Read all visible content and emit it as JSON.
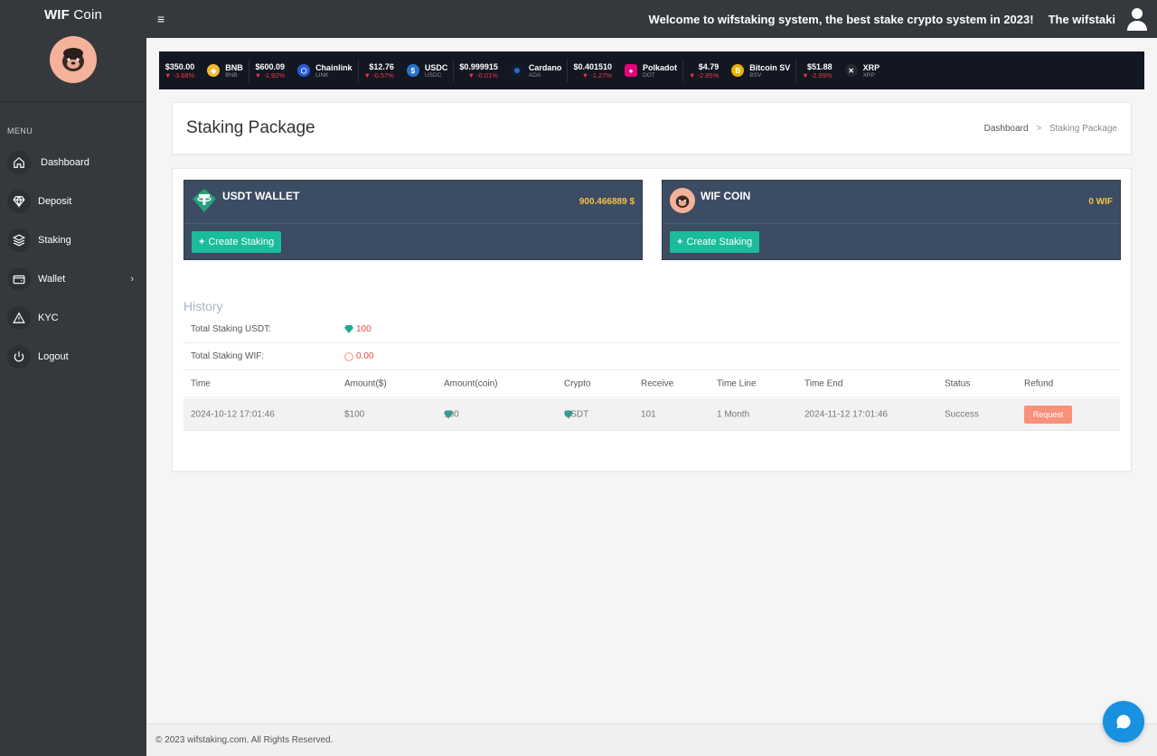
{
  "brand": {
    "name_bold": "WIF",
    "name_rest": " Coin"
  },
  "sidebar": {
    "menu_title": "MENU",
    "items": [
      {
        "label": "Dashboard",
        "icon": "home-icon"
      },
      {
        "label": "Deposit",
        "icon": "diamond-icon"
      },
      {
        "label": "Staking",
        "icon": "layers-icon"
      },
      {
        "label": "Wallet",
        "icon": "wallet-icon",
        "chevron": "›"
      },
      {
        "label": "KYC",
        "icon": "warning-icon"
      },
      {
        "label": "Logout",
        "icon": "power-icon"
      }
    ]
  },
  "header": {
    "menu_glyph": "≡",
    "welcome": "Welcome to wifstaking system, the best stake crypto system in 2023!",
    "username": "The wifstaki"
  },
  "ticker": [
    {
      "price": "$350.00",
      "change": "▼ -3.68%",
      "name": "BNB",
      "sym": "BNB",
      "color": "#f3ba2f"
    },
    {
      "price": "$600.09",
      "change": "▼ -1.92%",
      "name": "Chainlink",
      "sym": "LINK",
      "color": "#2a5ada"
    },
    {
      "price": "$12.76",
      "change": "▼ -0.57%",
      "name": "USDC",
      "sym": "USDC",
      "color": "#2775ca"
    },
    {
      "price": "$0.999915",
      "change": "▼ -0.01%",
      "name": "Cardano",
      "sym": "ADA",
      "color": "#0d1e30"
    },
    {
      "price": "$0.401510",
      "change": "▼ -1.27%",
      "name": "Polkadot",
      "sym": "DOT",
      "color": "#e6007a"
    },
    {
      "price": "$4.79",
      "change": "▼ -2.95%",
      "name": "Bitcoin SV",
      "sym": "BSV",
      "color": "#eab300"
    },
    {
      "price": "$51.88",
      "change": "▼ -2.99%",
      "name": "XRP",
      "sym": "XRP",
      "color": "#23292f"
    }
  ],
  "page": {
    "title": "Staking Package",
    "breadcrumb_home": "Dashboard",
    "breadcrumb_sep": ">",
    "breadcrumb_current": "Staking Package"
  },
  "wallets": [
    {
      "name": "USDT WALLET",
      "balance": "900.466889 $",
      "button": "Create Staking"
    },
    {
      "name": "WIF COIN",
      "balance": "0 WIF",
      "button": "Create Staking"
    }
  ],
  "history": {
    "title": "History",
    "total_usdt_label": "Total Staking USDT:",
    "total_usdt_value": "100",
    "total_wif_label": "Total Staking WIF:",
    "total_wif_value": "0.00",
    "columns": [
      "Time",
      "Amount($)",
      "Amount(coin)",
      "Crypto",
      "Receive",
      "Time Line",
      "Time End",
      "Status",
      "Refund"
    ],
    "rows": [
      {
        "time": "2024-10-12 17:01:46",
        "amount_usd": "$100",
        "amount_coin": "100",
        "crypto": "USDT",
        "receive": "101",
        "timeline": "1 Month",
        "time_end": "2024-11-12 17:01:46",
        "status": "Success",
        "refund": "Request"
      }
    ]
  },
  "footer": {
    "text": "© 2023 wifstaking.com. All Rights Reserved."
  },
  "colors": {
    "sidebar": "#35393d",
    "wallet_card": "#3c4c62",
    "accent_green": "#1abc9c",
    "balance_gold": "#f6c142",
    "request_btn": "#f8907a",
    "chat": "#1791e0"
  }
}
